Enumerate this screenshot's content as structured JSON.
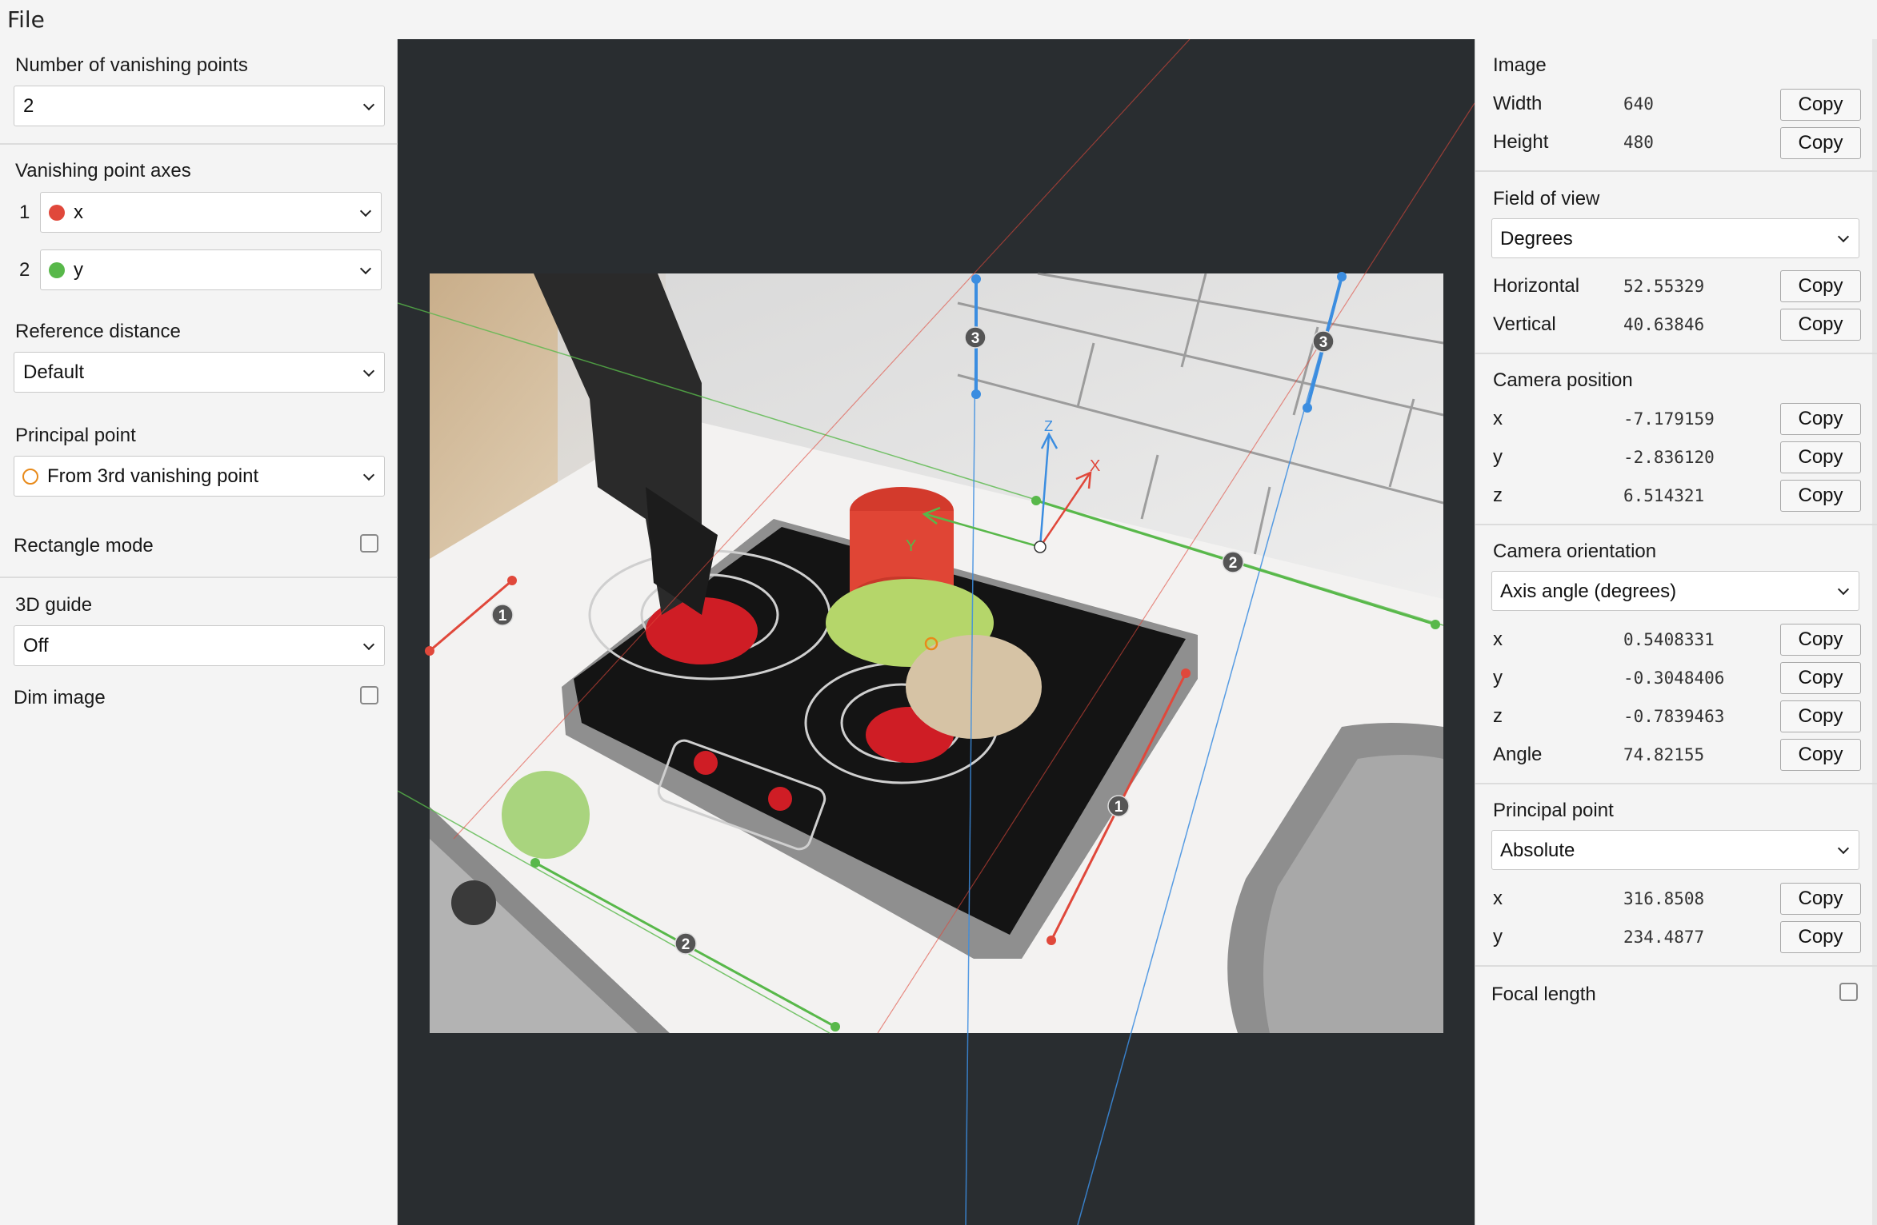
{
  "menu": {
    "file": "File"
  },
  "left": {
    "num_vp": {
      "label": "Number of vanishing points",
      "value": "2"
    },
    "vp_axes": {
      "label": "Vanishing point axes",
      "items": [
        {
          "index": "1",
          "axis": "x",
          "color": "#e0483b"
        },
        {
          "index": "2",
          "axis": "y",
          "color": "#58b84a"
        }
      ]
    },
    "ref_distance": {
      "label": "Reference distance",
      "value": "Default"
    },
    "principal_point": {
      "label": "Principal point",
      "value": "From 3rd vanishing point",
      "marker_color": "#e88a1a"
    },
    "rectangle_mode": {
      "label": "Rectangle mode",
      "checked": false
    },
    "guide_3d": {
      "label": "3D guide",
      "value": "Off"
    },
    "dim_image": {
      "label": "Dim image",
      "checked": false
    }
  },
  "canvas": {
    "vp_labels": {
      "x_line": "1",
      "y_line": "2",
      "z_line": "3"
    },
    "axis_labels": {
      "x": "X",
      "y": "Y",
      "z": "Z"
    },
    "colors": {
      "x": "#e0483b",
      "y": "#58b84a",
      "z": "#3b8de0",
      "principal": "#e88a1a"
    }
  },
  "right": {
    "copy_label": "Copy",
    "image": {
      "title": "Image",
      "rows": [
        {
          "label": "Width",
          "value": "640"
        },
        {
          "label": "Height",
          "value": "480"
        }
      ]
    },
    "fov": {
      "title": "Field of view",
      "unit": "Degrees",
      "rows": [
        {
          "label": "Horizontal",
          "value": "52.55329"
        },
        {
          "label": "Vertical",
          "value": "40.63846"
        }
      ]
    },
    "camera_position": {
      "title": "Camera position",
      "rows": [
        {
          "label": "x",
          "value": "-7.179159"
        },
        {
          "label": "y",
          "value": "-2.836120"
        },
        {
          "label": "z",
          "value": "6.514321"
        }
      ]
    },
    "camera_orientation": {
      "title": "Camera orientation",
      "mode": "Axis angle (degrees)",
      "rows": [
        {
          "label": "x",
          "value": "0.5408331"
        },
        {
          "label": "y",
          "value": "-0.3048406"
        },
        {
          "label": "z",
          "value": "-0.7839463"
        },
        {
          "label": "Angle",
          "value": "74.82155"
        }
      ]
    },
    "principal_point": {
      "title": "Principal point",
      "mode": "Absolute",
      "rows": [
        {
          "label": "x",
          "value": "316.8508"
        },
        {
          "label": "y",
          "value": "234.4877"
        }
      ]
    },
    "focal_length": {
      "label": "Focal length",
      "checked": false
    }
  }
}
